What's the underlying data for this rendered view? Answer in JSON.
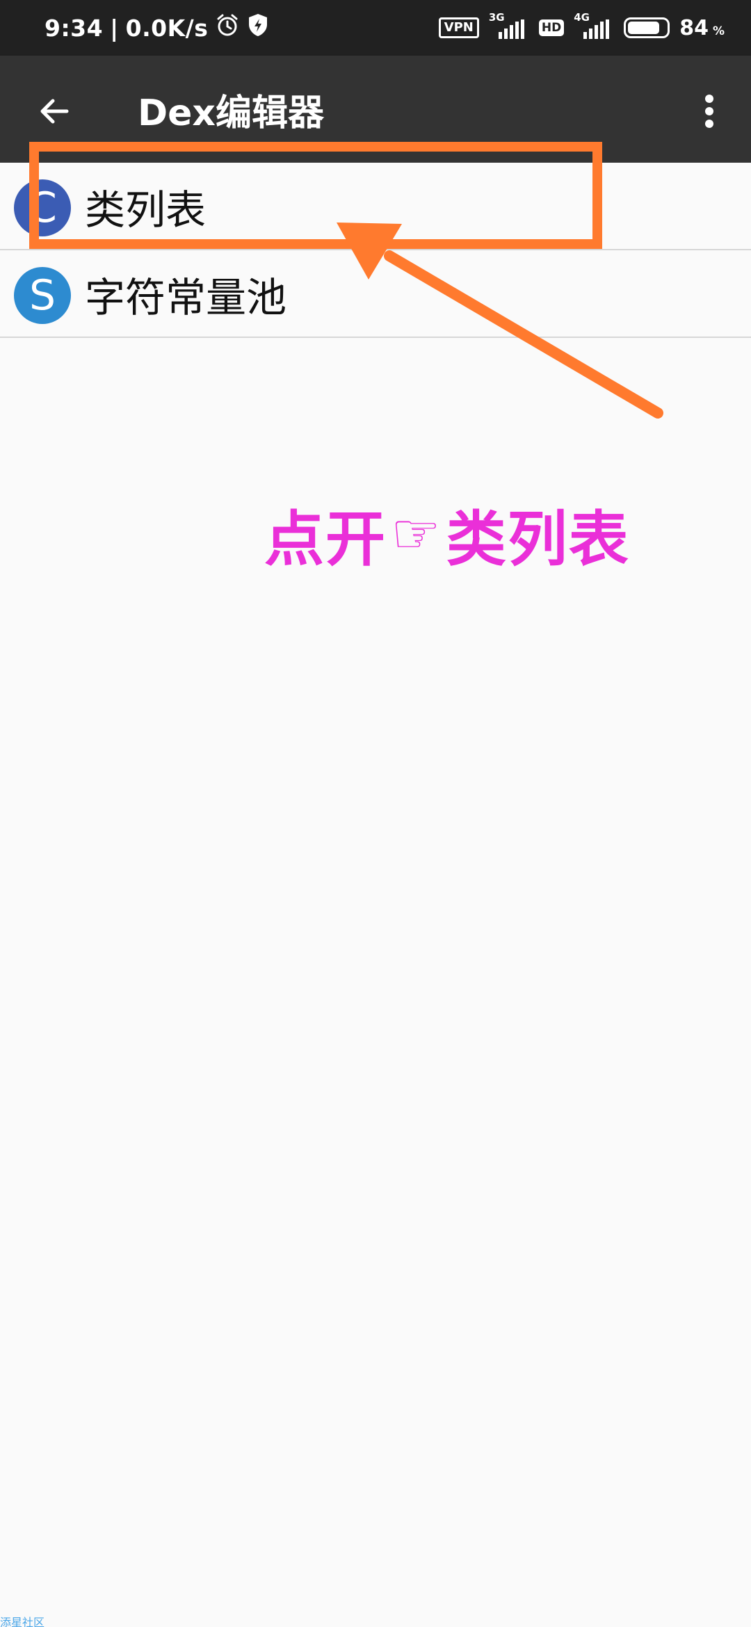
{
  "status_bar": {
    "time": "9:34",
    "separator": "|",
    "network_speed": "0.0K/s",
    "vpn_label": "VPN",
    "network_3g_label": "3G",
    "hd_label": "HD",
    "network_4g_label": "4G",
    "battery_level": "84",
    "battery_unit": "%",
    "battery_fraction": 0.84,
    "icons": [
      "alarm-icon",
      "shield-icon",
      "signal-icon",
      "battery-icon"
    ]
  },
  "app_bar": {
    "title": "Dex编辑器",
    "back_icon": "arrow-left-icon",
    "more_icon": "more-vertical-icon"
  },
  "list": {
    "items": [
      {
        "avatar_letter": "C",
        "label": "类列表",
        "avatar_color": "#3b5cb4"
      },
      {
        "avatar_letter": "S",
        "label": "字符常量池",
        "avatar_color": "#2d8bd0"
      }
    ]
  },
  "annotation": {
    "text_before": "点开",
    "hand_glyph": "☞",
    "text_after": "类列表",
    "text_color": "#ea2fd8",
    "highlight_color": "#ff7a2e"
  },
  "watermark": "添星社区"
}
